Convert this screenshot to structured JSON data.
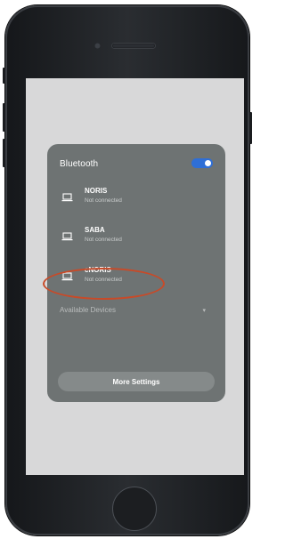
{
  "bluetooth": {
    "title": "Bluetooth",
    "enabled": true,
    "toggle_color": "#2f6fd6"
  },
  "devices": [
    {
      "name": "NORIS",
      "status": "Not connected",
      "icon": "laptop-icon"
    },
    {
      "name": "SABA",
      "status": "Not connected",
      "icon": "laptop-icon"
    },
    {
      "name": "cNORIS",
      "status": "Not connected",
      "icon": "laptop-icon",
      "highlighted": true
    }
  ],
  "available_devices": {
    "label": "Available Devices"
  },
  "actions": {
    "more_settings_label": "More Settings"
  },
  "colors": {
    "panel_bg": "#6e7373",
    "highlight": "#c84a28",
    "screen_bg": "#d8d8d9"
  }
}
